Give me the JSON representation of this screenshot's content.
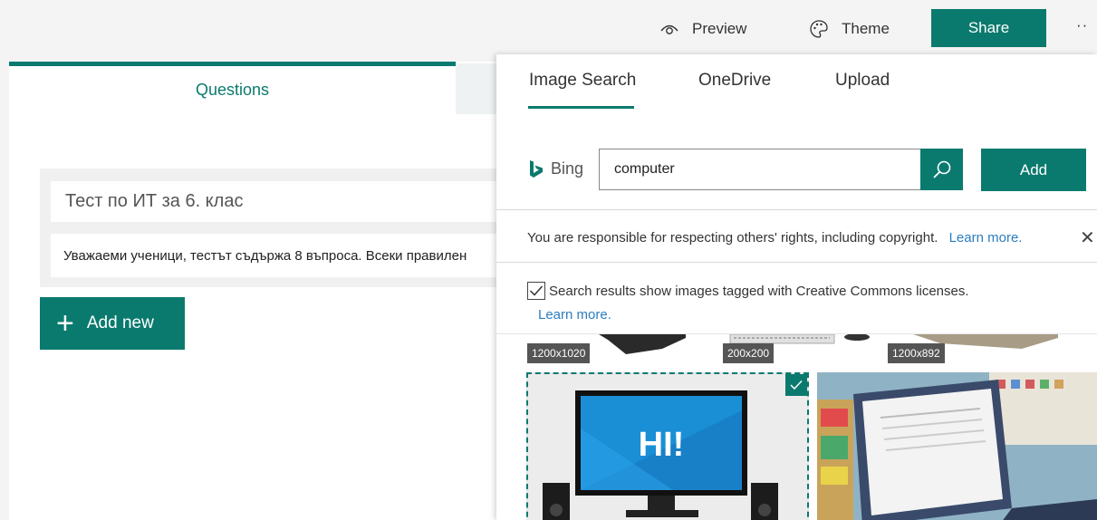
{
  "topbar": {
    "preview_label": "Preview",
    "theme_label": "Theme",
    "share_label": "Share",
    "more_label": "··"
  },
  "editor": {
    "questions_tab": "Questions",
    "form_title": "Тест по ИТ за 6. клас",
    "form_description": "Уважаеми ученици, тестът съдържа 8 въпроса. Всеки правилен",
    "add_new_label": "Add new"
  },
  "panel": {
    "tabs": [
      {
        "label": "Image Search",
        "active": true
      },
      {
        "label": "OneDrive",
        "active": false
      },
      {
        "label": "Upload",
        "active": false
      }
    ],
    "bing_label": "Bing",
    "search_value": "computer",
    "add_label": "Add",
    "notice_text": "You are responsible for respecting others' rights, including copyright.",
    "notice_link": "Learn more.",
    "cc_checked": true,
    "cc_text": "Search results show images tagged with Creative Commons licenses.",
    "cc_link": "Learn more.",
    "results": [
      {
        "size": "1200x1020"
      },
      {
        "size": "200x200"
      },
      {
        "size": "1200x892"
      },
      {
        "overlay_text": "HI!",
        "selected": true
      },
      {
        "selected": false
      }
    ]
  },
  "colors": {
    "accent": "#0b7a6e",
    "link": "#2b7dbf",
    "chrome": "#f4f4f4"
  }
}
